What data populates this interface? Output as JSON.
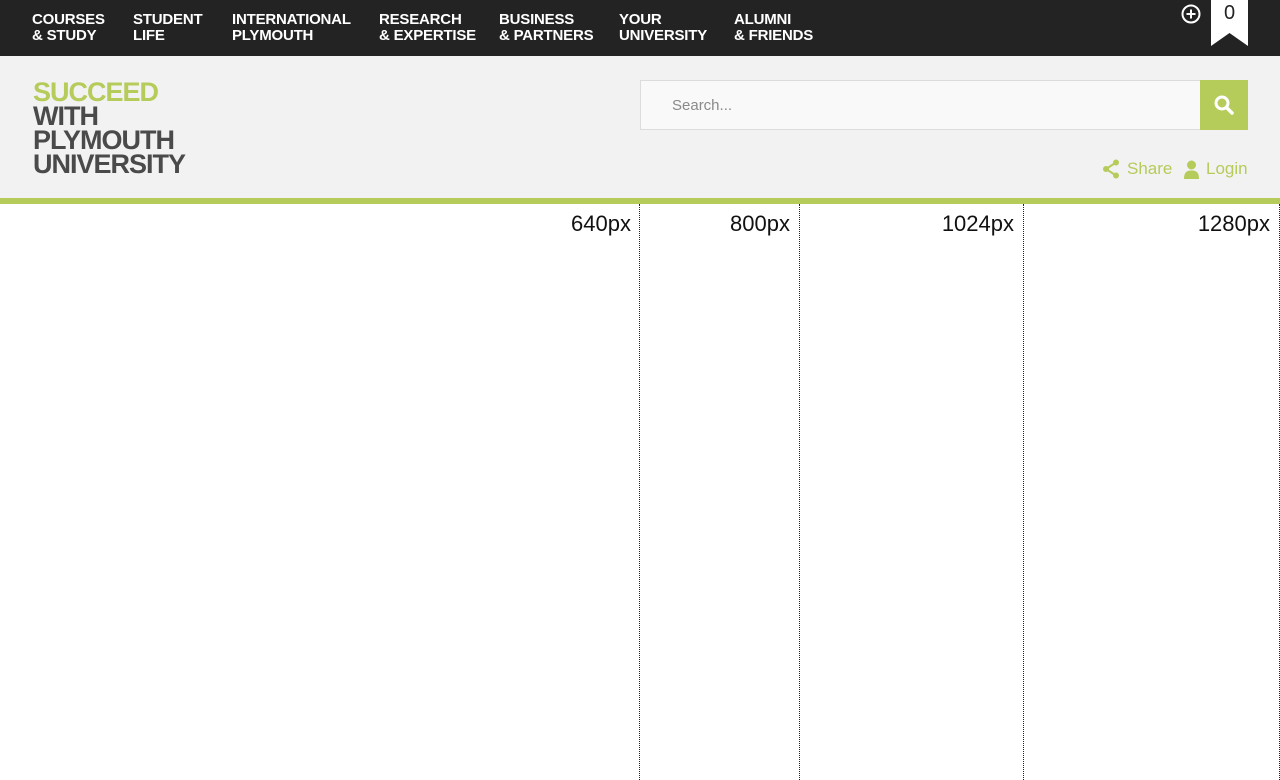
{
  "nav": {
    "items": [
      {
        "line1": "COURSES",
        "line2": "& STUDY"
      },
      {
        "line1": "STUDENT",
        "line2": "LIFE"
      },
      {
        "line1": "INTERNATIONAL",
        "line2": "PLYMOUTH"
      },
      {
        "line1": "RESEARCH",
        "line2": "& EXPERTISE"
      },
      {
        "line1": "BUSINESS",
        "line2": "& PARTNERS"
      },
      {
        "line1": "YOUR",
        "line2": "UNIVERSITY"
      },
      {
        "line1": "ALUMNI",
        "line2": "& FRIENDS"
      }
    ],
    "plus_icon": "plus-circle-icon",
    "bookmark_icon": "bookmark-icon",
    "bookmark_count": "0"
  },
  "logo": {
    "line1": "SUCCEED",
    "line2": "WITH",
    "line3": "PLYMOUTH",
    "line4": "UNIVERSITY"
  },
  "search": {
    "placeholder": "Search...",
    "value": "",
    "button_icon": "search-icon"
  },
  "utility": {
    "share_label": "Share",
    "share_icon": "share-icon",
    "login_label": "Login",
    "login_icon": "user-icon"
  },
  "breakpoints": {
    "labels": [
      "640px",
      "800px",
      "1024px",
      "1280px"
    ]
  },
  "colors": {
    "accent": "#b5cb5a",
    "nav_background": "#232323",
    "header_background": "#f2f2f2",
    "logo_dark": "#4a4a4a"
  }
}
